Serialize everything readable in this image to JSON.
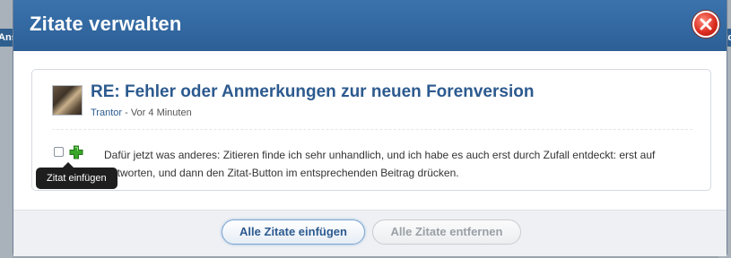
{
  "background": {
    "left_nav_fragment": "Ans",
    "right_nav_fragment": "nto"
  },
  "dialog": {
    "title": "Zitate verwalten",
    "quote": {
      "title": "RE: Fehler oder Anmerkungen zur neuen Forenversion",
      "author": "Trantor",
      "time": " - Vor 4 Minuten",
      "text": "Dafür jetzt was anderes: Zitieren finde ich sehr unhandlich, und ich habe es auch erst durch Zufall entdeckt: erst auf Antworten, und dann den Zitat-Button im entsprechenden Beitrag drücken.",
      "checked": false
    },
    "tooltip": "Zitat einfügen",
    "buttons": {
      "insert_all": "Alle Zitate einfügen",
      "remove_all": "Alle Zitate entfernen"
    }
  },
  "colors": {
    "titlebar": "#2c5f96",
    "link": "#2c5a8f",
    "close": "#d8291c",
    "add": "#3aa52a"
  },
  "icons": {
    "close": "close-icon",
    "add": "plus-icon"
  }
}
